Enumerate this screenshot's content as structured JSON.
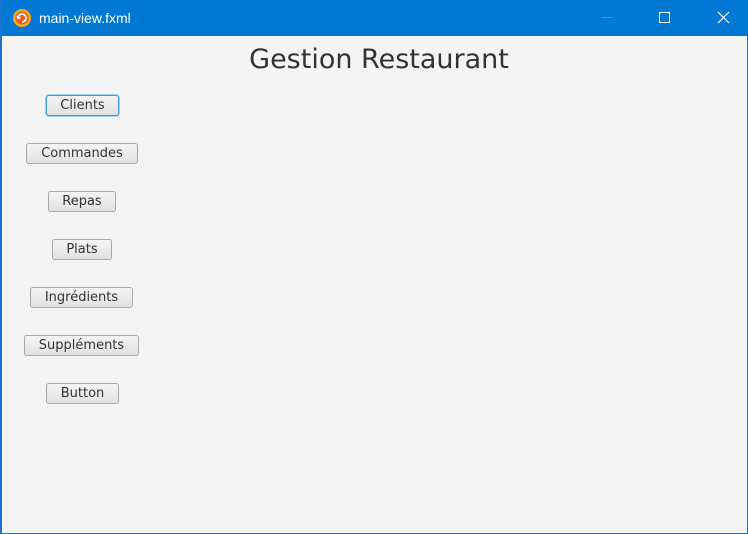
{
  "window": {
    "title": "main-view.fxml",
    "accent_color": "#0078d4",
    "controls": [
      "minimize-icon",
      "maximize-icon",
      "close-icon"
    ]
  },
  "main": {
    "heading": "Gestion Restaurant",
    "buttons": [
      {
        "label": "Clients",
        "focused": true
      },
      {
        "label": "Commandes"
      },
      {
        "label": "Repas"
      },
      {
        "label": "Plats"
      },
      {
        "label": "Ingrédients"
      },
      {
        "label": "Suppléments"
      },
      {
        "label": "Button"
      }
    ]
  }
}
